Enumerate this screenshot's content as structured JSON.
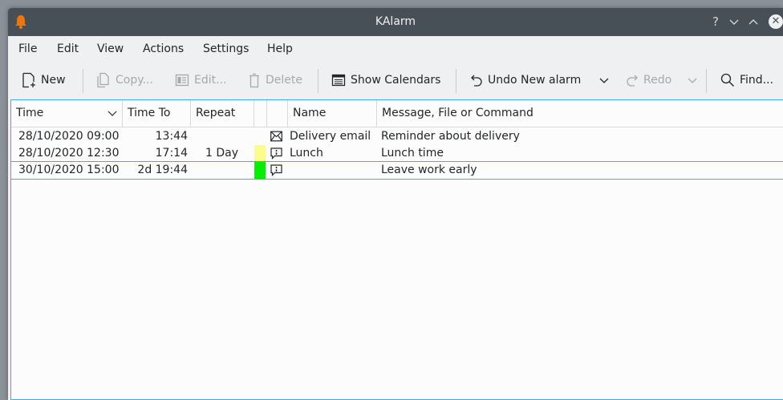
{
  "window": {
    "title": "KAlarm"
  },
  "titlebar": {
    "help": "?",
    "minimize": "⌄",
    "maximize": "⌃",
    "close": "✕"
  },
  "menu": [
    "File",
    "Edit",
    "View",
    "Actions",
    "Settings",
    "Help"
  ],
  "toolbar": {
    "new": "New",
    "copy": "Copy...",
    "edit": "Edit...",
    "delete": "Delete",
    "show_calendars": "Show Calendars",
    "undo": "Undo New alarm",
    "redo": "Redo",
    "find": "Find..."
  },
  "columns": {
    "time": "Time",
    "time_to": "Time To",
    "repeat": "Repeat",
    "color": "",
    "type": "",
    "name": "Name",
    "message": "Message, File or Command"
  },
  "alarms": [
    {
      "time": "28/10/2020 09:00",
      "time_to": "13:44",
      "repeat": "",
      "color": "",
      "type": "email-icon",
      "name": "Delivery email",
      "message": "Reminder about delivery"
    },
    {
      "time": "28/10/2020 12:30",
      "time_to": "17:14",
      "repeat": "1 Day",
      "color": "#fcfc8c",
      "type": "message-icon",
      "name": "Lunch",
      "message": "Lunch time"
    },
    {
      "time": "30/10/2020 15:00",
      "time_to": "2d 19:44",
      "repeat": "",
      "color": "#00f000",
      "type": "message-icon",
      "name": "",
      "message": "Leave work early"
    }
  ],
  "colors": {
    "titlebar": "#475057",
    "accent": "#3daee9",
    "window": "#eff0f1",
    "view": "#fcfcfc"
  }
}
